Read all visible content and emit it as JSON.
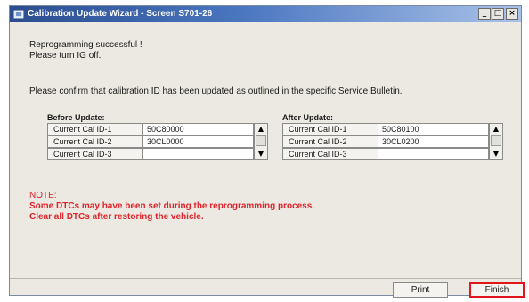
{
  "window": {
    "title": "Calibration Update Wizard - Screen S701-26",
    "controls": {
      "minimize": "_",
      "maximize": "□",
      "close": "×"
    }
  },
  "messages": {
    "line1": "Reprogramming successful !",
    "line2": "Please turn IG off.",
    "confirm": "Please confirm that calibration ID has been updated as outlined in the specific Service Bulletin."
  },
  "before": {
    "title": "Before Update:",
    "rows": [
      {
        "label": "Current Cal ID-1",
        "value": "50C80000"
      },
      {
        "label": "Current Cal ID-2",
        "value": "30CL0000"
      },
      {
        "label": "Current Cal ID-3",
        "value": ""
      }
    ]
  },
  "after": {
    "title": "After Update:",
    "rows": [
      {
        "label": "Current Cal ID-1",
        "value": "50C80100"
      },
      {
        "label": "Current Cal ID-2",
        "value": "30CL0200"
      },
      {
        "label": "Current Cal ID-3",
        "value": ""
      }
    ]
  },
  "scroll_arrows": {
    "up": "▲",
    "down": "▼"
  },
  "note": {
    "title": "NOTE:",
    "line1": "Some DTCs may have been set during the reprogramming process.",
    "line2": "Clear all DTCs after restoring the vehicle.",
    "color": "#e0232a"
  },
  "buttons": {
    "print": "Print",
    "finish": "Finish",
    "finish_highlight": "#e0161c"
  }
}
